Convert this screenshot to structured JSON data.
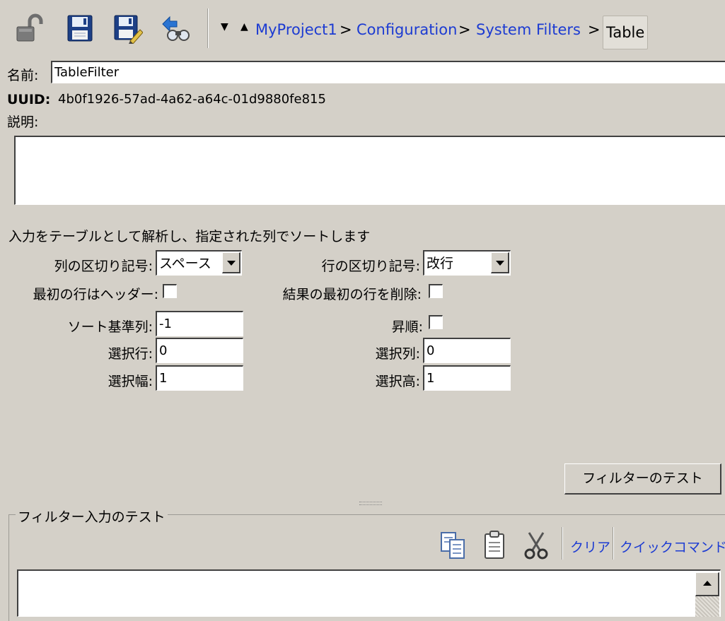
{
  "toolbar": {
    "icons": [
      "unlock-icon",
      "save-icon",
      "save-as-icon",
      "find-usages-icon"
    ],
    "nav_down": "▼",
    "nav_up": "▲",
    "breadcrumb": {
      "items": [
        "MyProject1",
        "Configuration",
        "System Filters"
      ],
      "separator": ">",
      "current": "Table"
    }
  },
  "form": {
    "name_label": "名前:",
    "name_value": "TableFilter",
    "uuid_label": "UUID:",
    "uuid_value": "4b0f1926-57ad-4a62-a64c-01d9880fe815",
    "description_label": "説明:",
    "description_value": ""
  },
  "filter": {
    "summary": "入力をテーブルとして解析し、指定された列でソートします",
    "column_delimiter_label": "列の区切り記号:",
    "column_delimiter_value": "スペース",
    "row_delimiter_label": "行の区切り記号:",
    "row_delimiter_value": "改行",
    "first_row_header_label": "最初の行はヘッダー:",
    "first_row_header_checked": false,
    "delete_first_row_label": "結果の最初の行を削除:",
    "delete_first_row_checked": false,
    "sort_column_label": "ソート基準列:",
    "sort_column_value": "-1",
    "ascending_label": "昇順:",
    "ascending_checked": false,
    "select_row_label": "選択行:",
    "select_row_value": "0",
    "select_column_label": "選択列:",
    "select_column_value": "0",
    "select_width_label": "選択幅:",
    "select_width_value": "1",
    "select_height_label": "選択高:",
    "select_height_value": "1",
    "test_button_label": "フィルターのテスト"
  },
  "test_panel": {
    "title": "フィルター入力のテスト",
    "icons": [
      "copy-icon",
      "paste-icon",
      "cut-icon"
    ],
    "clear_label": "クリア",
    "quick_command_label": "クイックコマンド",
    "input_value": ""
  },
  "colors": {
    "background": "#d4d0c8",
    "link": "#1c3bd2",
    "field": "#ffffff"
  }
}
